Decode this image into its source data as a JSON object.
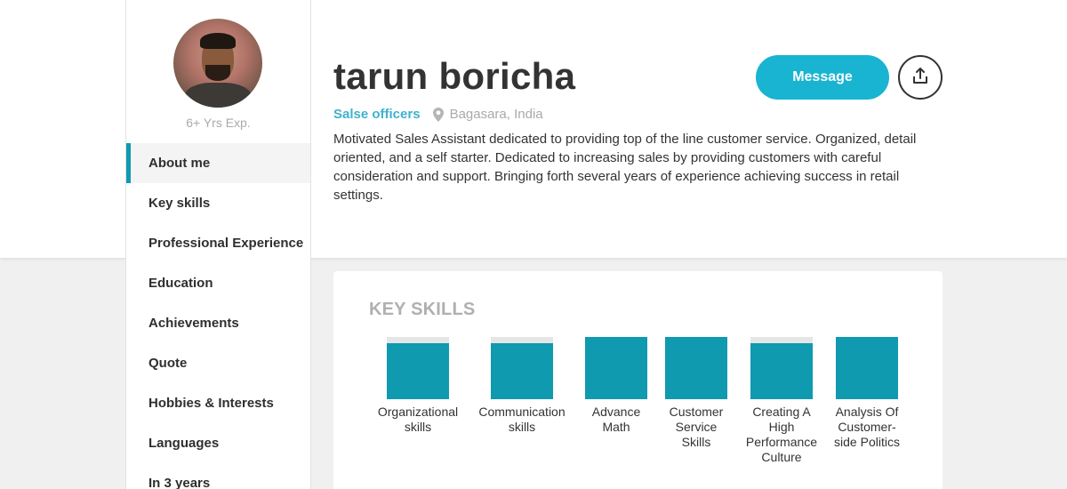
{
  "profile": {
    "name": "tarun boricha",
    "experience": "6+ Yrs Exp.",
    "title": "Salse officers",
    "location": "Bagasara, India",
    "bio": "Motivated Sales Assistant dedicated to providing top of the line customer service. Organized, detail oriented, and a self starter. Dedicated to increasing sales by providing customers with careful consideration and support. Bringing forth several years of experience achieving success in retail settings."
  },
  "actions": {
    "message_label": "Message",
    "share_icon": "share-icon"
  },
  "nav": {
    "items": [
      {
        "label": "About me",
        "active": true
      },
      {
        "label": "Key skills"
      },
      {
        "label": "Professional Experience"
      },
      {
        "label": "Education"
      },
      {
        "label": "Achievements"
      },
      {
        "label": "Quote"
      },
      {
        "label": "Hobbies & Interests"
      },
      {
        "label": "Languages"
      },
      {
        "label": "In 3 years"
      }
    ]
  },
  "skills": {
    "heading": "KEY SKILLS",
    "items": [
      {
        "label": "Organizational skills",
        "level": 0.9
      },
      {
        "label": "Communication skills",
        "level": 0.9
      },
      {
        "label": "Advance Math",
        "level": 1.0
      },
      {
        "label": "Customer Service Skills",
        "level": 1.0
      },
      {
        "label": "Creating A High Performance Culture",
        "level": 0.9
      },
      {
        "label": "Analysis Of Customer-side Politics",
        "level": 1.0
      }
    ]
  },
  "colors": {
    "accent": "#19b4d1",
    "bar": "#0f9ab0",
    "bar_track": "#e6e6e6",
    "title": "#3fb2cc"
  }
}
